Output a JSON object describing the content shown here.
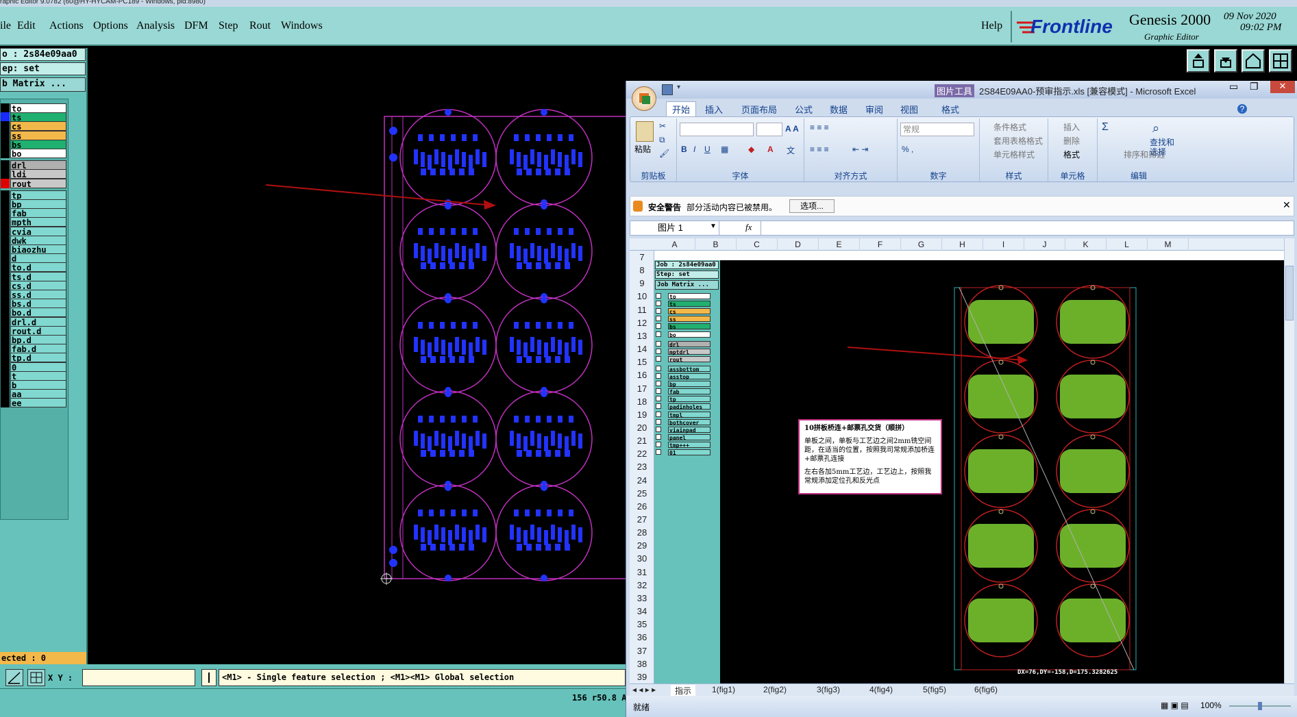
{
  "window_title": "raphic Editor 9.0782 (60@HY-HYCAM-PC189 - Windows, pid:8980)",
  "menu": [
    "ile",
    "Edit",
    "Actions",
    "Options",
    "Analysis",
    "DFM",
    "Step",
    "Rout",
    "Windows"
  ],
  "help": "Help",
  "brand": {
    "logo": "Frontline",
    "product": "Genesis 2000",
    "subtitle": "Graphic Editor",
    "date": "09 Nov 2020",
    "time": "09:02 PM"
  },
  "job": {
    "job": "o : 2s84e09aa0",
    "step": "ep: set",
    "matrix": "b Matrix ..."
  },
  "layers": [
    {
      "name": "to",
      "swatch": "#000000",
      "fill": "#ffffff"
    },
    {
      "name": "ts",
      "swatch": "#1a2aff",
      "fill": "#20b070"
    },
    {
      "name": "cs",
      "swatch": "#000000",
      "fill": "#f2b84a"
    },
    {
      "name": "ss",
      "swatch": "#000000",
      "fill": "#f2b84a"
    },
    {
      "name": "bs",
      "swatch": "#000000",
      "fill": "#20b070"
    },
    {
      "name": "bo",
      "swatch": "#000000",
      "fill": "#ffffff"
    },
    {
      "name": "drl",
      "swatch": "#000000",
      "fill": "#b0b0b0"
    },
    {
      "name": "ldi",
      "swatch": "#000000",
      "fill": "#c8c8c8"
    },
    {
      "name": "rout",
      "swatch": "#e00000",
      "fill": "#c8c8c8"
    },
    {
      "name": "tp",
      "swatch": "#000000",
      "fill": "#80d8d0"
    },
    {
      "name": "bp",
      "swatch": "#000000",
      "fill": "#80d8d0"
    },
    {
      "name": "fab",
      "swatch": "#000000",
      "fill": "#80d8d0"
    },
    {
      "name": "mpth",
      "swatch": "#000000",
      "fill": "#80d8d0"
    },
    {
      "name": "cvia",
      "swatch": "#000000",
      "fill": "#80d8d0"
    },
    {
      "name": "dwk",
      "swatch": "#000000",
      "fill": "#80d8d0"
    },
    {
      "name": "biaozhu",
      "swatch": "#000000",
      "fill": "#80d8d0"
    },
    {
      "name": "d",
      "swatch": "#000000",
      "fill": "#80d8d0"
    },
    {
      "name": "to.d",
      "swatch": "#000000",
      "fill": "#80d8d0"
    },
    {
      "name": "ts.d",
      "swatch": "#000000",
      "fill": "#80d8d0"
    },
    {
      "name": "cs.d",
      "swatch": "#000000",
      "fill": "#80d8d0"
    },
    {
      "name": "ss.d",
      "swatch": "#000000",
      "fill": "#80d8d0"
    },
    {
      "name": "bs.d",
      "swatch": "#000000",
      "fill": "#80d8d0"
    },
    {
      "name": "bo.d",
      "swatch": "#000000",
      "fill": "#80d8d0"
    },
    {
      "name": "drl.d",
      "swatch": "#000000",
      "fill": "#80d8d0"
    },
    {
      "name": "rout.d",
      "swatch": "#000000",
      "fill": "#80d8d0"
    },
    {
      "name": "bp.d",
      "swatch": "#000000",
      "fill": "#80d8d0"
    },
    {
      "name": "fab.d",
      "swatch": "#000000",
      "fill": "#80d8d0"
    },
    {
      "name": "tp.d",
      "swatch": "#000000",
      "fill": "#80d8d0"
    },
    {
      "name": "0",
      "swatch": "#000000",
      "fill": "#80d8d0"
    },
    {
      "name": "t",
      "swatch": "#000000",
      "fill": "#80d8d0"
    },
    {
      "name": "b",
      "swatch": "#000000",
      "fill": "#80d8d0"
    },
    {
      "name": "aa",
      "swatch": "#000000",
      "fill": "#80d8d0"
    },
    {
      "name": "ee",
      "swatch": "#000000",
      "fill": "#80d8d0"
    }
  ],
  "selected": "ected : 0",
  "xy_label": "X Y :",
  "prompt": "<M1> - Single feature selection ; <M1><M1> Global selection",
  "coords": "156 r50.8 A",
  "excel": {
    "title_context": "图片工具",
    "title": "2S84E09AA0-预审指示.xls [兼容模式] - Microsoft Excel",
    "tabs": [
      "开始",
      "插入",
      "页面布局",
      "公式",
      "数据",
      "审阅",
      "视图",
      "格式"
    ],
    "groups": {
      "clipboard": "剪贴板",
      "font": "字体",
      "align": "对齐方式",
      "number": "数字",
      "styles": "样式",
      "cells": "单元格",
      "edit": "编辑"
    },
    "paste": "粘贴",
    "number_format": "常规",
    "styles_items": [
      "条件格式",
      "套用表格格式",
      "单元格样式"
    ],
    "cells_items": [
      "插入",
      "删除",
      "格式"
    ],
    "edit_items": [
      "排序和筛选",
      "查找和选择"
    ],
    "security_title": "安全警告",
    "security_msg": "部分活动内容已被禁用。",
    "security_btn": "选项...",
    "namebox": "图片 1",
    "fx": "fx",
    "columns": [
      "A",
      "B",
      "C",
      "D",
      "E",
      "F",
      "G",
      "H",
      "I",
      "J",
      "K",
      "L",
      "M"
    ],
    "rows": [
      "7",
      "8",
      "9",
      "10",
      "11",
      "12",
      "13",
      "14",
      "15",
      "16",
      "17",
      "18",
      "19",
      "20",
      "21",
      "22",
      "23",
      "24",
      "25",
      "26",
      "27",
      "28",
      "29",
      "30",
      "31",
      "32",
      "33",
      "34",
      "35",
      "36",
      "37",
      "38",
      "39"
    ],
    "sheet_tabs": [
      "指示",
      "1(fig1)",
      "2(fig2)",
      "3(fig3)",
      "4(fig4)",
      "5(fig5)",
      "6(fig6)"
    ],
    "status": "就绪",
    "zoom": "100%",
    "pic": {
      "job": "Job : 2s84e09aa0",
      "step": "Step: set",
      "matrix": "Job Matrix ...",
      "layers": [
        {
          "name": "to",
          "fill": "#ffffff"
        },
        {
          "name": "ts",
          "fill": "#20b070"
        },
        {
          "name": "cs",
          "fill": "#f2b84a"
        },
        {
          "name": "ss",
          "fill": "#f2b84a"
        },
        {
          "name": "bs",
          "fill": "#20b070"
        },
        {
          "name": "bo",
          "fill": "#ffffff"
        },
        {
          "name": "drl",
          "fill": "#b0b0b0"
        },
        {
          "name": "mptdrl",
          "fill": "#c8c8c8"
        },
        {
          "name": "rout",
          "fill": "#c8c8c8"
        },
        {
          "name": "assbottom",
          "fill": "#80d8d0"
        },
        {
          "name": "asstop",
          "fill": "#80d8d0"
        },
        {
          "name": "bp",
          "fill": "#80d8d0"
        },
        {
          "name": "fab",
          "fill": "#80d8d0"
        },
        {
          "name": "tp",
          "fill": "#80d8d0"
        },
        {
          "name": "padinholes",
          "fill": "#80d8d0"
        },
        {
          "name": "tmpl",
          "fill": "#80d8d0"
        },
        {
          "name": "bothcover",
          "fill": "#80d8d0"
        },
        {
          "name": "viainpad",
          "fill": "#80d8d0"
        },
        {
          "name": "panel",
          "fill": "#80d8d0"
        },
        {
          "name": "tmp+++",
          "fill": "#80d8d0"
        },
        {
          "name": "01",
          "fill": "#80d8d0"
        }
      ],
      "note_title": "10拼板桥连+邮票孔交货（顺拼）",
      "note_p1": "单板之间，单板与工艺边之间2mm铣空间距，在适当的位置，按照我司常规添加桥连+邮票孔连接",
      "note_p2": "左右各加5mm工艺边，工艺边上，按照我常规添加定位孔和反光点",
      "measure": "DX=76,DY=-158,D=175.3282625"
    }
  }
}
